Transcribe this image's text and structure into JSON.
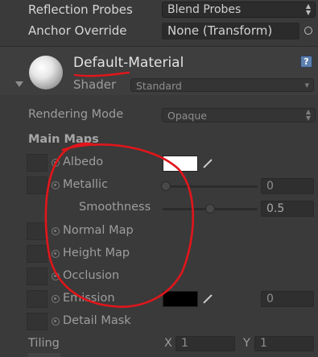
{
  "renderer": {
    "reflection_probes_label": "Reflection Probes",
    "reflection_probes_value": "Blend Probes",
    "anchor_override_label": "Anchor Override",
    "anchor_override_value": "None (Transform)"
  },
  "material": {
    "name": "Default-Material",
    "shader_label": "Shader",
    "shader_value": "Standard",
    "help_icon": "book-help-icon"
  },
  "properties": {
    "rendering_mode_label": "Rendering Mode",
    "rendering_mode_value": "Opaque",
    "main_maps_label": "Main Maps",
    "albedo_label": "Albedo",
    "albedo_color": "#ffffff",
    "metallic_label": "Metallic",
    "metallic_value": "0",
    "smoothness_label": "Smoothness",
    "smoothness_value": "0.5",
    "normal_map_label": "Normal Map",
    "height_map_label": "Height Map",
    "occlusion_label": "Occlusion",
    "emission_label": "Emission",
    "emission_color": "#000000",
    "emission_value": "0",
    "detail_mask_label": "Detail Mask",
    "tiling_label": "Tiling",
    "tiling_x_label": "X",
    "tiling_x_value": "1",
    "tiling_y_label": "Y",
    "tiling_y_value": "1"
  },
  "colors": {
    "annotation": "#e0161b",
    "panel_bg": "#3a3a3a"
  }
}
